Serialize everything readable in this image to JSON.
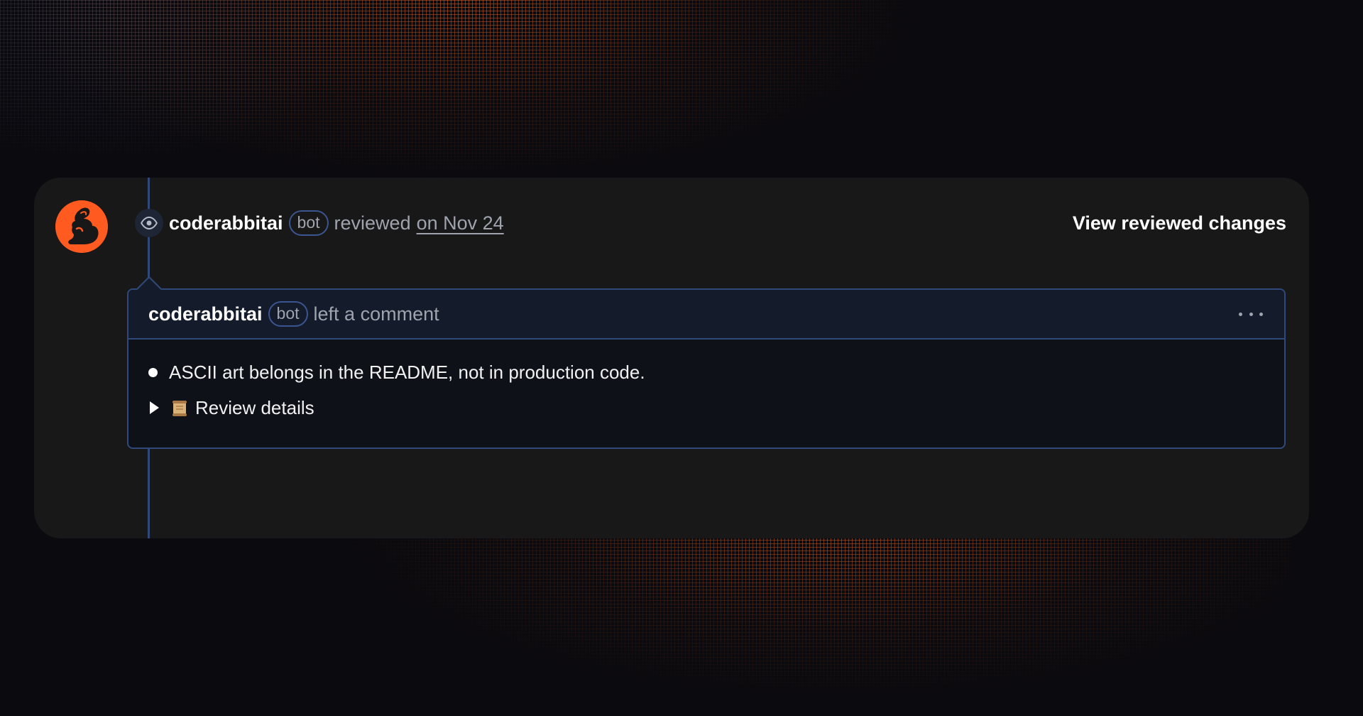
{
  "review": {
    "username": "coderabbitai",
    "bot_label": "bot",
    "action": "reviewed",
    "date_link": "on Nov 24",
    "view_changes_label": "View reviewed changes"
  },
  "comment": {
    "username": "coderabbitai",
    "bot_label": "bot",
    "action": "left a comment",
    "bullet_text": "ASCII art belongs in the README, not in production code.",
    "details_label": "Review details",
    "details_icon": "scroll-icon"
  },
  "colors": {
    "accent": "#ff5a1f",
    "timeline": "#2f4a7a",
    "card_bg": "#181818",
    "comment_header_bg": "#141c2c"
  }
}
